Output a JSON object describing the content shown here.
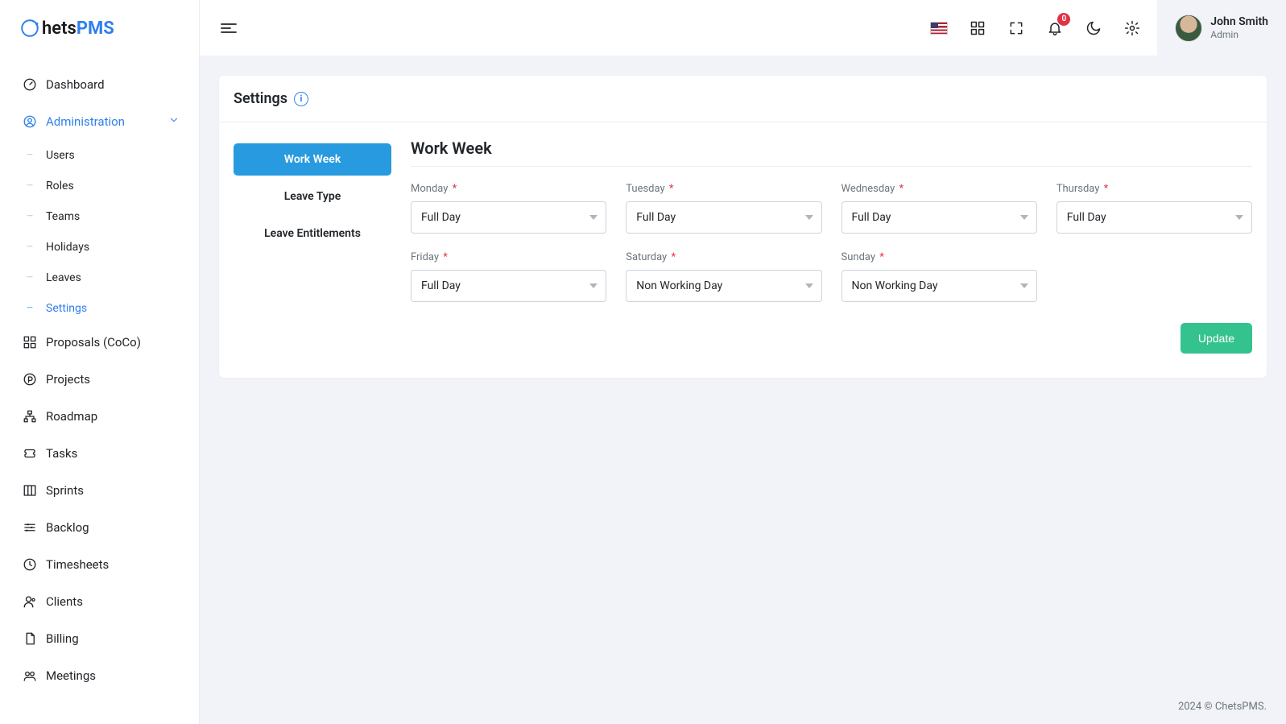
{
  "brand": {
    "prefix": "C",
    "mid": "hets",
    "suffix": "PMS"
  },
  "user": {
    "name": "John Smith",
    "role": "Admin"
  },
  "topbar": {
    "notification_count": "0"
  },
  "sidebar": {
    "items": [
      {
        "label": "Dashboard"
      },
      {
        "label": "Administration"
      },
      {
        "label": "Proposals (CoCo)"
      },
      {
        "label": "Projects"
      },
      {
        "label": "Roadmap"
      },
      {
        "label": "Tasks"
      },
      {
        "label": "Sprints"
      },
      {
        "label": "Backlog"
      },
      {
        "label": "Timesheets"
      },
      {
        "label": "Clients"
      },
      {
        "label": "Billing"
      },
      {
        "label": "Meetings"
      }
    ],
    "admin_sub": [
      {
        "label": "Users"
      },
      {
        "label": "Roles"
      },
      {
        "label": "Teams"
      },
      {
        "label": "Holidays"
      },
      {
        "label": "Leaves"
      },
      {
        "label": "Settings"
      }
    ]
  },
  "page": {
    "title": "Settings",
    "tabs": [
      {
        "label": "Work Week"
      },
      {
        "label": "Leave Type"
      },
      {
        "label": "Leave Entitlements"
      }
    ],
    "panel_title": "Work Week",
    "days": [
      {
        "label": "Monday",
        "value": "Full Day"
      },
      {
        "label": "Tuesday",
        "value": "Full Day"
      },
      {
        "label": "Wednesday",
        "value": "Full Day"
      },
      {
        "label": "Thursday",
        "value": "Full Day"
      },
      {
        "label": "Friday",
        "value": "Full Day"
      },
      {
        "label": "Saturday",
        "value": "Non Working Day"
      },
      {
        "label": "Sunday",
        "value": "Non Working Day"
      }
    ],
    "update_label": "Update"
  },
  "footer": {
    "text": "2024 © ChetsPMS."
  }
}
